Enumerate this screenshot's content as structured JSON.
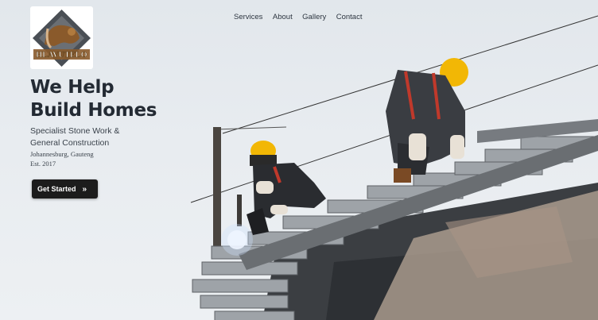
{
  "brand": {
    "logo_text": "HLAVUTELO",
    "colors": {
      "logo_brown": "#8a5a2b",
      "logo_gray": "#4a4f55"
    }
  },
  "nav": {
    "items": [
      {
        "label": "Services"
      },
      {
        "label": "About"
      },
      {
        "label": "Gallery"
      },
      {
        "label": "Contact"
      }
    ]
  },
  "hero": {
    "title_line1": "We Help",
    "title_line2": "Build Homes",
    "subtitle_line1": "Specialist Stone Work &",
    "subtitle_line2": "General Construction",
    "location": "Johannesburg, Gauteng",
    "established": "Est. 2017",
    "cta_label": "Get Started",
    "cta_icon": "double-chevron-right-icon",
    "image": "construction workers welding steel staircase"
  },
  "colors": {
    "text": "#232a33",
    "button": "#1c1c1c",
    "helmet": "#f2b705"
  }
}
